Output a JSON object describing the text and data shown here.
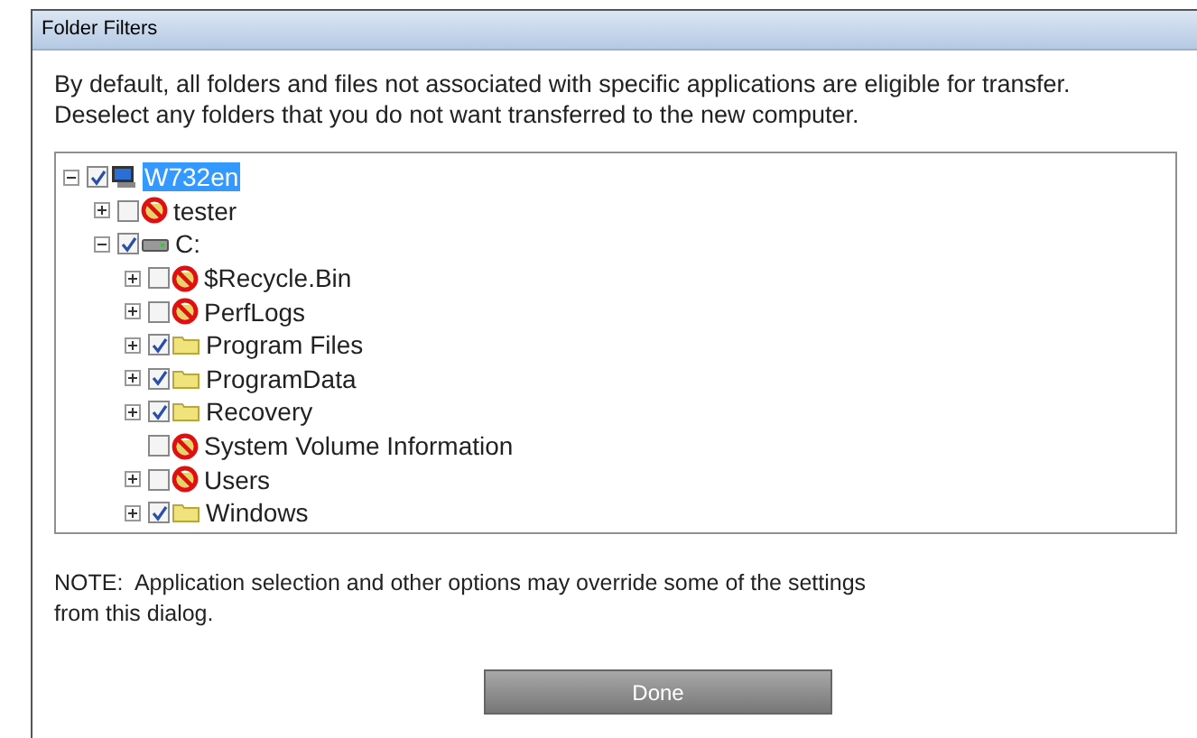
{
  "window": {
    "title": "Folder Filters"
  },
  "intro": [
    "By default, all folders and files not associated with specific applications are eligible for transfer.",
    "Deselect any folders that you do not want transferred to the new computer."
  ],
  "tree": [
    {
      "label": "W732en",
      "kind": "computer",
      "checked": true,
      "selected": true,
      "expandable": true,
      "expanded": true,
      "children": [
        {
          "label": "tester",
          "kind": "excluded",
          "checked": false,
          "selected": false,
          "expandable": true,
          "expanded": false
        },
        {
          "label": "C:",
          "kind": "drive",
          "checked": true,
          "selected": false,
          "expandable": true,
          "expanded": true,
          "children": [
            {
              "label": "$Recycle.Bin",
              "kind": "excluded",
              "checked": false,
              "selected": false,
              "expandable": true,
              "expanded": false
            },
            {
              "label": "PerfLogs",
              "kind": "excluded",
              "checked": false,
              "selected": false,
              "expandable": true,
              "expanded": false
            },
            {
              "label": "Program Files",
              "kind": "folder",
              "checked": true,
              "selected": false,
              "expandable": true,
              "expanded": false
            },
            {
              "label": "ProgramData",
              "kind": "folder",
              "checked": true,
              "selected": false,
              "expandable": true,
              "expanded": false
            },
            {
              "label": "Recovery",
              "kind": "folder",
              "checked": true,
              "selected": false,
              "expandable": true,
              "expanded": false
            },
            {
              "label": "System Volume Information",
              "kind": "excluded",
              "checked": false,
              "selected": false,
              "expandable": false,
              "expanded": false
            },
            {
              "label": "Users",
              "kind": "excluded",
              "checked": false,
              "selected": false,
              "expandable": true,
              "expanded": false
            },
            {
              "label": "Windows",
              "kind": "folder",
              "checked": true,
              "selected": false,
              "expandable": true,
              "expanded": false
            }
          ]
        }
      ]
    }
  ],
  "note": [
    "NOTE:  Application selection and other options may override some of the settings",
    "from this dialog."
  ],
  "done_button": "Done"
}
